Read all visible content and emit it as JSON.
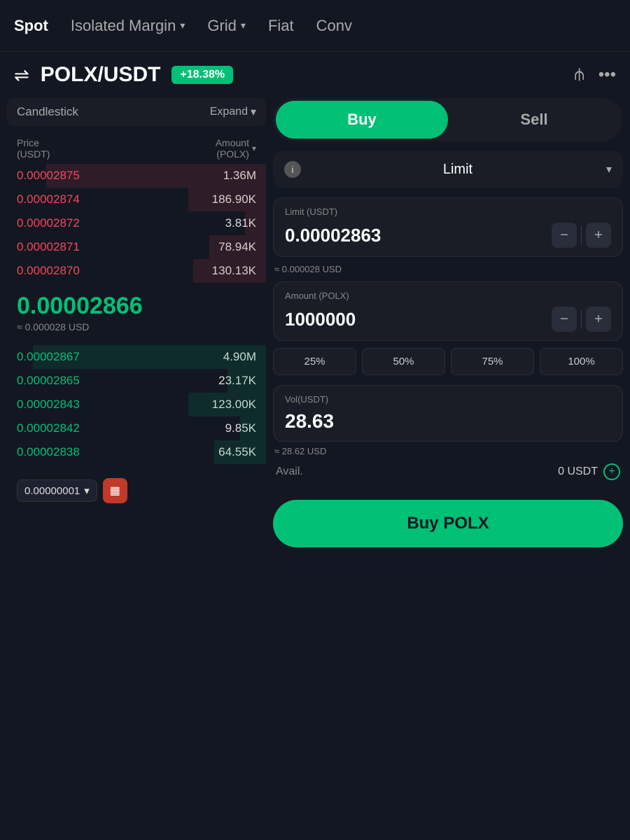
{
  "nav": {
    "items": [
      {
        "id": "spot",
        "label": "Spot",
        "active": true
      },
      {
        "id": "isolated-margin",
        "label": "Isolated Margin",
        "hasDropdown": true
      },
      {
        "id": "grid",
        "label": "Grid",
        "hasDropdown": true
      },
      {
        "id": "fiat",
        "label": "Fiat"
      },
      {
        "id": "conv",
        "label": "Conv"
      }
    ]
  },
  "header": {
    "pair": "POLX/USDT",
    "priceChange": "+18.38%",
    "swapIcon": "⇌"
  },
  "candlestick": {
    "label": "Candlestick",
    "expandLabel": "Expand"
  },
  "orderBook": {
    "columns": {
      "price": "Price\n(USDT)",
      "amount": "Amount\n(POLX)"
    },
    "asks": [
      {
        "price": "0.00002875",
        "amount": "1.36M",
        "barWidth": "85"
      },
      {
        "price": "0.00002874",
        "amount": "186.90K",
        "barWidth": "30"
      },
      {
        "price": "0.00002872",
        "amount": "3.81K",
        "barWidth": "8"
      },
      {
        "price": "0.00002871",
        "amount": "78.94K",
        "barWidth": "22"
      },
      {
        "price": "0.00002870",
        "amount": "130.13K",
        "barWidth": "28"
      }
    ],
    "currentPrice": "0.00002866",
    "currentPriceUSD": "≈ 0.000028 USD",
    "bids": [
      {
        "price": "0.00002867",
        "amount": "4.90M",
        "barWidth": "90"
      },
      {
        "price": "0.00002865",
        "amount": "23.17K",
        "barWidth": "15"
      },
      {
        "price": "0.00002843",
        "amount": "123.00K",
        "barWidth": "30"
      },
      {
        "price": "0.00002842",
        "amount": "9.85K",
        "barWidth": "10"
      },
      {
        "price": "0.00002838",
        "amount": "64.55K",
        "barWidth": "20"
      }
    ]
  },
  "leftBottom": {
    "priceStep": "0.00000001",
    "gridIcon": "▦"
  },
  "tradeForm": {
    "buyLabel": "Buy",
    "sellLabel": "Sell",
    "orderType": "Limit",
    "limitLabel": "Limit (USDT)",
    "limitValue": "0.00002863",
    "limitApprox": "≈ 0.000028 USD",
    "amountLabel": "Amount (POLX)",
    "amountValue": "1000000",
    "pctButtons": [
      "25%",
      "50%",
      "75%",
      "100%"
    ],
    "volLabel": "Vol(USDT)",
    "volValue": "28.63",
    "volApprox": "≈ 28.62 USD",
    "availLabel": "Avail.",
    "availValue": "0 USDT",
    "buyBtnLabel": "Buy POLX"
  }
}
